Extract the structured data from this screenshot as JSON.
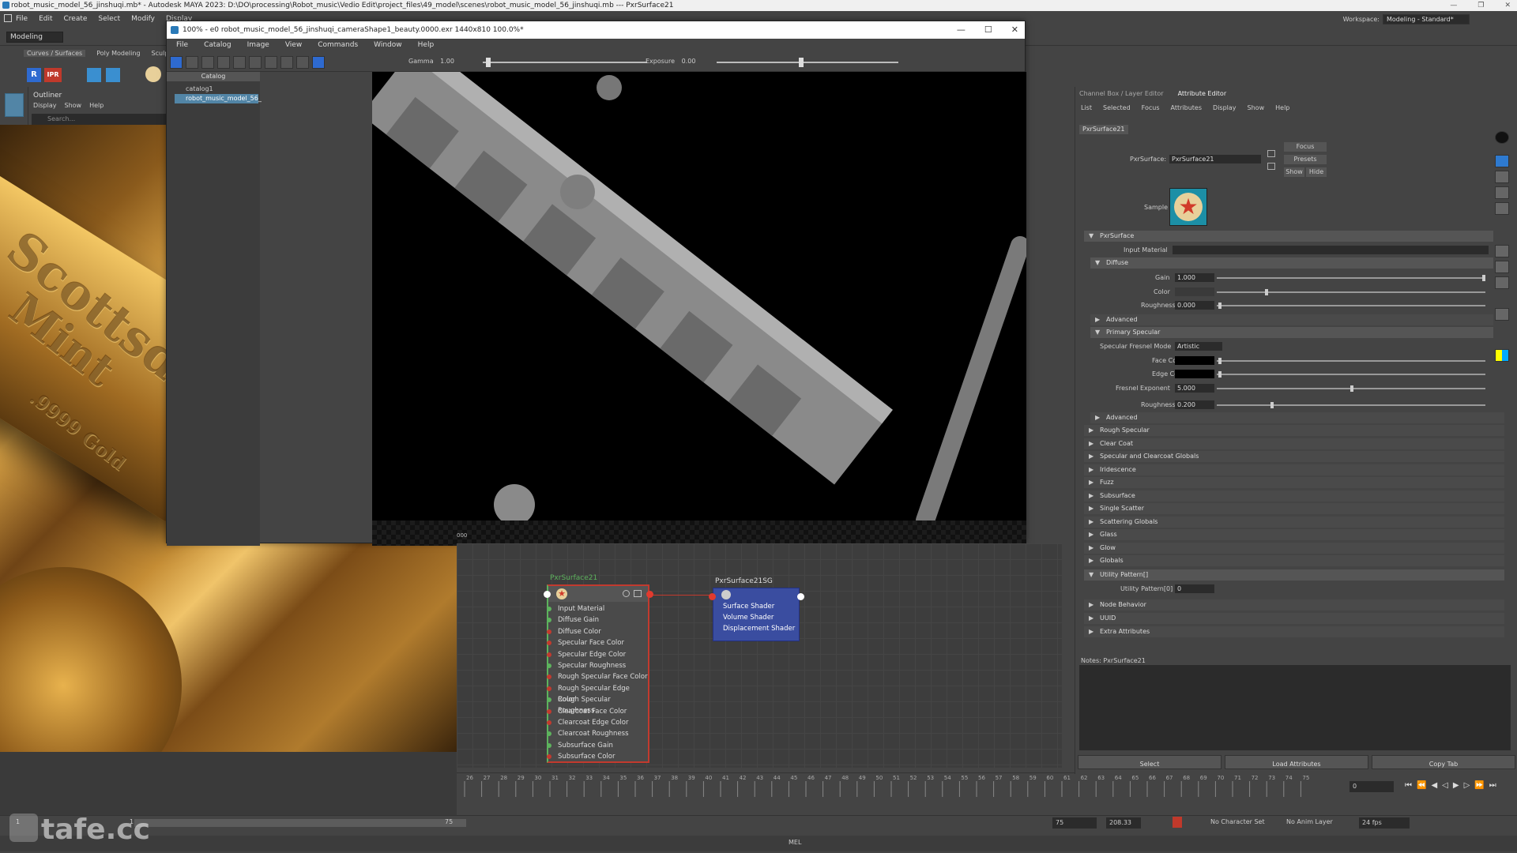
{
  "maya": {
    "title": "robot_music_model_56_jinshuqi.mb* - Autodesk MAYA 2023: D:\\DO\\processing\\Robot_music\\Vedio Edit\\project_files\\49_model\\scenes\\robot_music_model_56_jinshuqi.mb  ---  PxrSurface21",
    "menus": [
      "File",
      "Edit",
      "Create",
      "Select",
      "Modify",
      "Display"
    ],
    "mode": "Modeling",
    "workspace_label": "Workspace:",
    "workspace_value": "Modeling - Standard*",
    "shelf_tabs": [
      "Curves / Surfaces",
      "Poly Modeling",
      "Sculpt"
    ],
    "shelf_buttons": [
      "R",
      "IPR"
    ]
  },
  "outliner": {
    "title": "Outliner",
    "menus": [
      "Display",
      "Show",
      "Help"
    ],
    "search_placeholder": "Search..."
  },
  "renderview": {
    "title": "100% - e0 robot_music_model_56_jinshuqi_cameraShape1_beauty.0000.exr 1440x810 100.0%*",
    "menus": [
      "File",
      "Catalog",
      "Image",
      "View",
      "Commands",
      "Window",
      "Help"
    ],
    "gamma_label": "Gamma",
    "gamma_value": "1.00",
    "exposure_label": "Exposure",
    "exposure_value": "0.00",
    "catalog_header": "Catalog",
    "catalog_items": [
      "catalog1",
      "robot_music_model_56_"
    ],
    "small_value": "000"
  },
  "photo": {
    "engraving_line1": "Scottsdale",
    "engraving_line2": "Mint",
    "engraving_line3": ".9999 Gold"
  },
  "nodes": {
    "surface": {
      "title": "PxrSurface21",
      "ports": [
        "Input Material",
        "Diffuse Gain",
        "Diffuse Color",
        "Specular Face Color",
        "Specular Edge Color",
        "Specular Roughness",
        "Rough Specular Face Color",
        "Rough Specular Edge Color",
        "Rough Specular Roughness",
        "Clearcoat Face Color",
        "Clearcoat Edge Color",
        "Clearcoat Roughness",
        "Subsurface Gain",
        "Subsurface Color"
      ]
    },
    "sg": {
      "title": "PxrSurface21SG",
      "ports": [
        "Surface Shader",
        "Volume Shader",
        "Displacement Shader"
      ]
    }
  },
  "timeline": {
    "ticks": [
      "26",
      "27",
      "28",
      "29",
      "30",
      "31",
      "32",
      "33",
      "34",
      "35",
      "36",
      "37",
      "38",
      "39",
      "40",
      "41",
      "42",
      "43",
      "44",
      "45",
      "46",
      "47",
      "48",
      "49",
      "50",
      "51",
      "52",
      "53",
      "54",
      "55",
      "56",
      "57",
      "58",
      "59",
      "60",
      "61",
      "62",
      "63",
      "64",
      "65",
      "66",
      "67",
      "68",
      "69",
      "70",
      "71",
      "72",
      "73",
      "74",
      "75"
    ],
    "current_frame": "0",
    "range_start": "1",
    "range_end": "75",
    "field_a": "75",
    "field_b": "208.33",
    "character_set": "No Character Set",
    "anim_layer": "No Anim Layer",
    "fps": "24 fps",
    "cmd_label": "MEL"
  },
  "attribute_editor": {
    "tabs": [
      "Channel Box / Layer Editor",
      "Attribute Editor"
    ],
    "menu": [
      "List",
      "Selected",
      "Focus",
      "Attributes",
      "Display",
      "Show",
      "Help"
    ],
    "node_tab": "PxrSurface21",
    "type_label": "PxrSurface:",
    "type_value": "PxrSurface21",
    "focus_btn": "Focus",
    "presets_btn": "Presets",
    "show_btn": "Show",
    "hide_btn": "Hide",
    "sample_label": "Sample",
    "sections": {
      "pxrsurface": "PxrSurface",
      "input_material": "Input Material",
      "diffuse": "Diffuse",
      "gain_label": "Gain",
      "gain_value": "1.000",
      "color_label": "Color",
      "roughness_label": "Roughness",
      "roughness_value": "0.000",
      "advanced": "Advanced",
      "primary_specular": "Primary Specular",
      "fresnel_mode_label": "Specular Fresnel Mode",
      "fresnel_mode_value": "Artistic",
      "face_color": "Face Color",
      "edge_color": "Edge Color",
      "fresnel_exp_label": "Fresnel Exponent",
      "fresnel_exp_value": "5.000",
      "spec_rough_label": "Roughness",
      "spec_rough_value": "0.200",
      "advanced2": "Advanced"
    },
    "collapsed": [
      "Rough Specular",
      "Clear Coat",
      "Specular and Clearcoat Globals",
      "Iridescence",
      "Fuzz",
      "Subsurface",
      "Single Scatter",
      "Scattering Globals",
      "Glass",
      "Glow",
      "Globals"
    ],
    "utility_section": "Utility Pattern[]",
    "utility_label": "Utility Pattern[0]",
    "utility_value": "0",
    "bottom_sections": [
      "Node Behavior",
      "UUID",
      "Extra Attributes"
    ],
    "notes_label": "Notes: PxrSurface21",
    "buttons": [
      "Select",
      "Load Attributes",
      "Copy Tab"
    ]
  },
  "watermark": "tafe.cc"
}
